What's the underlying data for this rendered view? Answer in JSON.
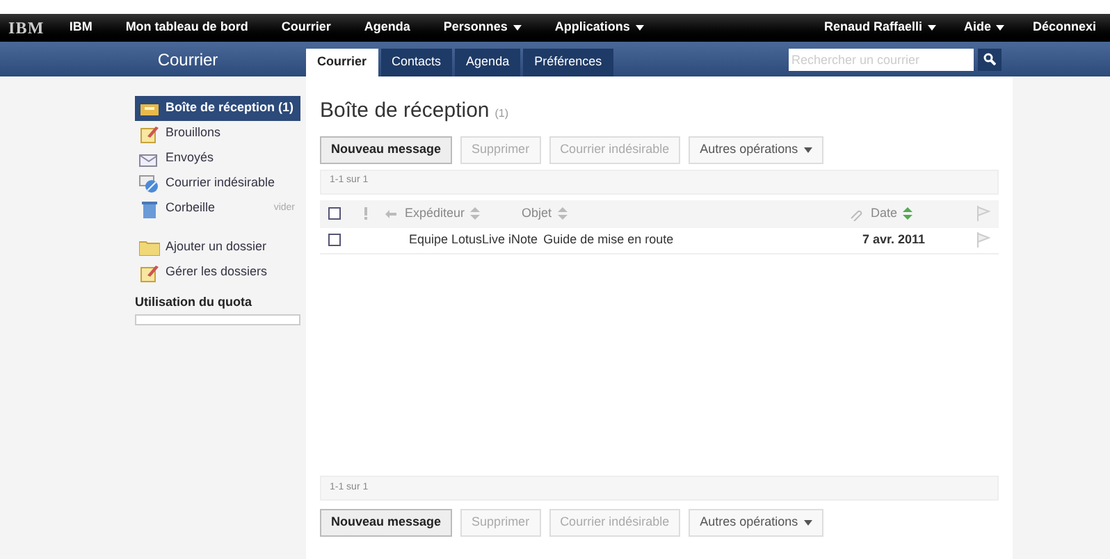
{
  "top_nav": {
    "logo": "IBM",
    "items": [
      {
        "label": "IBM",
        "dropdown": false
      },
      {
        "label": "Mon tableau de bord",
        "dropdown": false
      },
      {
        "label": "Courrier",
        "dropdown": false
      },
      {
        "label": "Agenda",
        "dropdown": false
      },
      {
        "label": "Personnes",
        "dropdown": true
      },
      {
        "label": "Applications",
        "dropdown": true
      }
    ],
    "right_items": [
      {
        "label": "Renaud Raffaelli",
        "dropdown": true
      },
      {
        "label": "Aide",
        "dropdown": true
      },
      {
        "label": "Déconnexi",
        "dropdown": false
      }
    ]
  },
  "section_title": "Courrier",
  "tabs": [
    {
      "label": "Courrier",
      "selected": true
    },
    {
      "label": "Contacts",
      "selected": false
    },
    {
      "label": "Agenda",
      "selected": false
    },
    {
      "label": "Préférences",
      "selected": false
    }
  ],
  "search": {
    "placeholder": "Rechercher un courrier"
  },
  "sidebar": {
    "folders": [
      {
        "kind": "inbox",
        "label": "Boîte de réception",
        "count": "(1)",
        "selected": true
      },
      {
        "kind": "drafts",
        "label": "Brouillons",
        "selected": false
      },
      {
        "kind": "sent",
        "label": "Envoyés",
        "selected": false
      },
      {
        "kind": "junk",
        "label": "Courrier indésirable",
        "selected": false
      },
      {
        "kind": "trash",
        "label": "Corbeille",
        "action": "vider",
        "selected": false
      }
    ],
    "actions": [
      {
        "kind": "add",
        "label": "Ajouter un dossier"
      },
      {
        "kind": "manage",
        "label": "Gérer les dossiers"
      }
    ],
    "quota": {
      "label": "Utilisation du quota"
    }
  },
  "main": {
    "title": "Boîte de réception",
    "count": "(1)",
    "toolbar": [
      {
        "label": "Nouveau message",
        "disabled": false,
        "dropdown": false
      },
      {
        "label": "Supprimer",
        "disabled": true,
        "dropdown": false
      },
      {
        "label": "Courrier indésirable",
        "disabled": true,
        "dropdown": false
      },
      {
        "label": "Autres opérations",
        "disabled": false,
        "dropdown": true
      }
    ],
    "pager": "1-1 sur 1",
    "columns": {
      "select_all_checked": false,
      "sender": "Expéditeur",
      "subject": "Objet",
      "date": "Date"
    },
    "rows": [
      {
        "checked": false,
        "sender": "Equipe LotusLive iNote",
        "subject": "Guide de mise en route",
        "date": "7 avr. 2011",
        "unread": true
      }
    ],
    "bottom_pager": "1-1 sur 1",
    "bottom_toolbar": [
      {
        "label": "Nouveau message",
        "disabled": false,
        "dropdown": false
      },
      {
        "label": "Supprimer",
        "disabled": true,
        "dropdown": false
      },
      {
        "label": "Courrier indésirable",
        "disabled": true,
        "dropdown": false
      },
      {
        "label": "Autres opérations",
        "disabled": false,
        "dropdown": true
      }
    ]
  }
}
